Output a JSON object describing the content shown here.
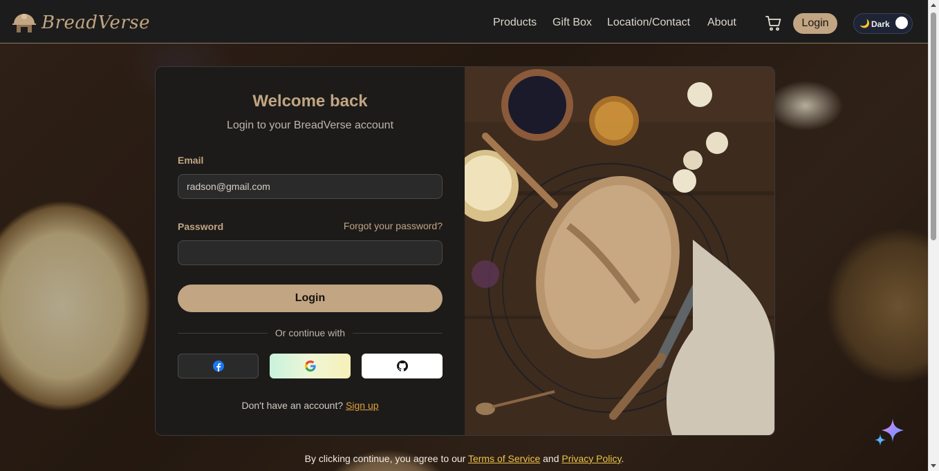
{
  "header": {
    "brand": "BreadVerse",
    "nav": [
      "Products",
      "Gift Box",
      "Location/Contact",
      "About"
    ],
    "cart_icon": "cart-icon",
    "login_label": "Login",
    "theme_label": "Dark",
    "theme_icon": "moon-icon"
  },
  "login_form": {
    "title": "Welcome back",
    "subtitle": "Login to your BreadVerse account",
    "email_label": "Email",
    "email_value": "radson@gmail.com",
    "password_label": "Password",
    "forgot_label": "Forgot your password?",
    "password_value": "",
    "submit_label": "Login",
    "divider_text": "Or continue with",
    "social": [
      {
        "name": "facebook",
        "icon": "facebook-icon"
      },
      {
        "name": "google",
        "icon": "google-icon"
      },
      {
        "name": "github",
        "icon": "github-icon"
      }
    ],
    "signup_prompt": "Don't have an account?",
    "signup_link": "Sign up"
  },
  "footer": {
    "terms_prefix": "By clicking continue, you agree to our",
    "terms_link": "Terms of Service",
    "and_text": "and",
    "privacy_link": "Privacy Policy",
    "terms_suffix": "."
  },
  "colors": {
    "accent": "#c2a582",
    "link_orange": "#e0a23b",
    "header_bg": "#1c1c1c",
    "card_bg": "#1c1b1a"
  }
}
